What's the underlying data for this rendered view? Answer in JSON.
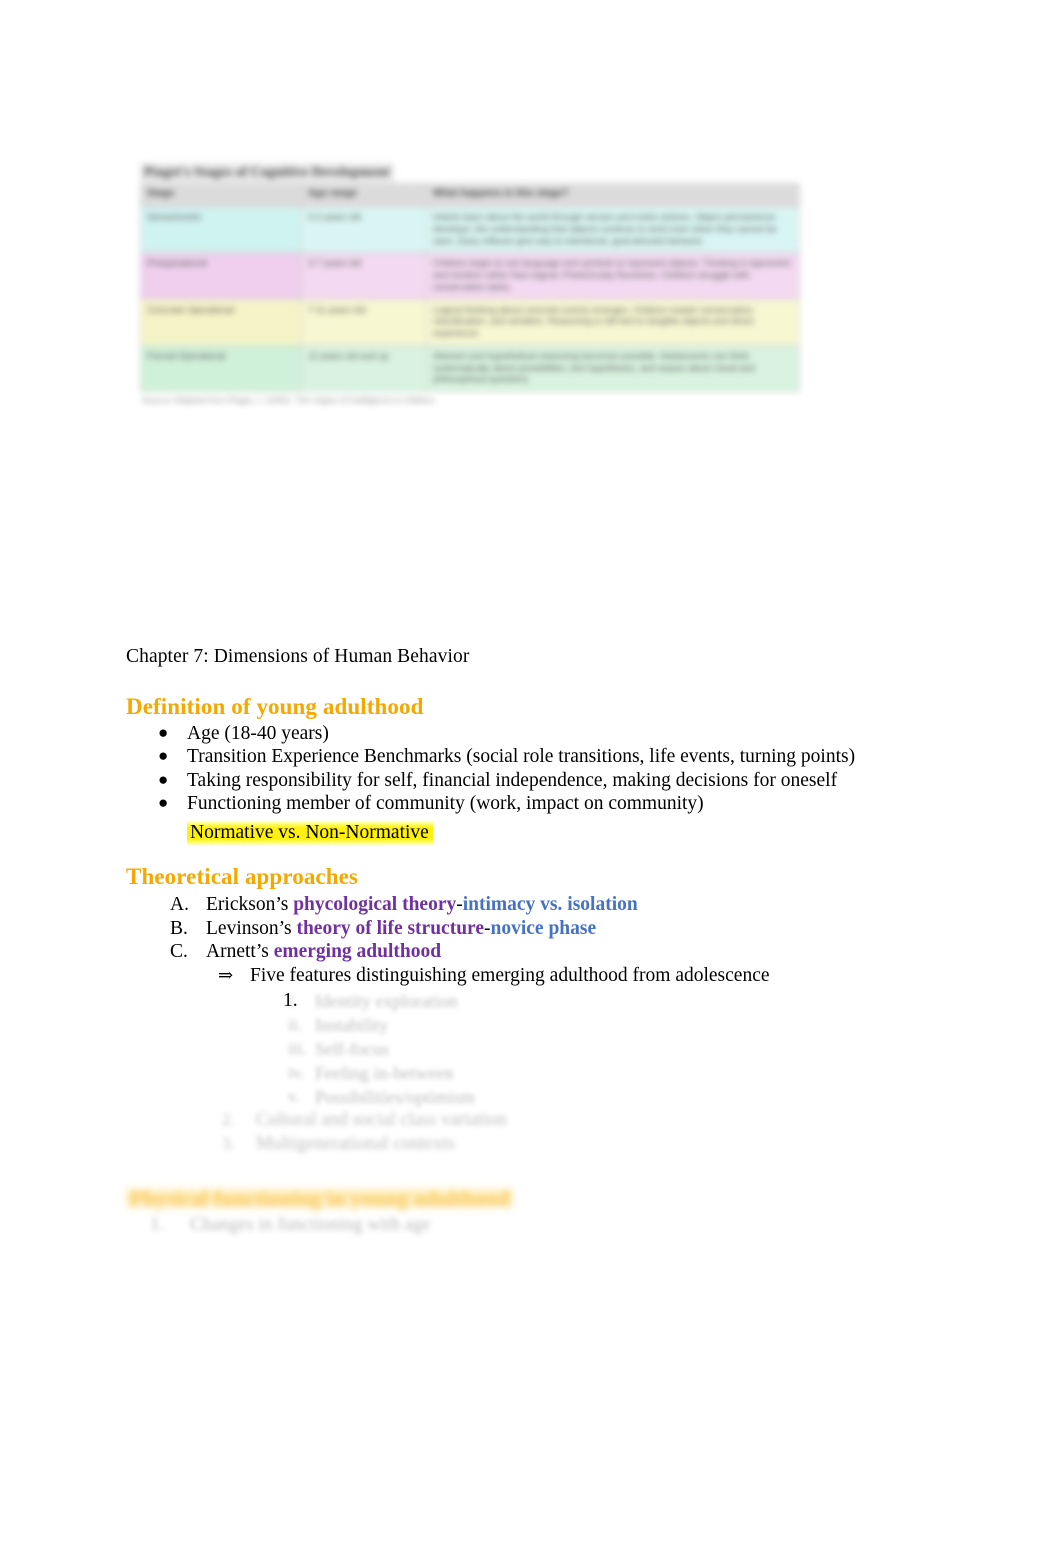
{
  "document": {
    "chapter_title": "Chapter 7: Dimensions of Human Behavior"
  },
  "figure": {
    "title": "Piaget's Stages of Cognitive Development",
    "caption": "Source: Adapted from Piaget, J. (1952). The origins of intelligence in children.",
    "columns": [
      "Stage",
      "Age range",
      "What happens in this stage?"
    ],
    "rows": [
      {
        "stage": "Sensorimotor",
        "age": "0-2 years old",
        "what": "Infants learn about the world through senses and motor actions. Object permanence develops: the understanding that objects continue to exist even when they cannot be seen. Early reflexes give way to intentional, goal-directed behavior."
      },
      {
        "stage": "Preoperational",
        "age": "2-7 years old",
        "what": "Children begin to use language and symbols to represent objects. Thinking is egocentric and intuitive rather than logical. Pretend play flourishes. Children struggle with conservation tasks."
      },
      {
        "stage": "Concrete Operational",
        "age": "7-11 years old",
        "what": "Logical thinking about concrete events emerges. Children master conservation, classification, and seriation. Reasoning is still tied to tangible objects and direct experience."
      },
      {
        "stage": "Formal Operational",
        "age": "12 years old and up",
        "what": "Abstract and hypothetical reasoning becomes possible. Adolescents can think systematically about possibilities, test hypotheses, and reason about moral and philosophical questions."
      }
    ]
  },
  "sections": [
    {
      "heading": "Definition of young adulthood",
      "bullets": [
        "Age (18-40 years)",
        "Transition Experience Benchmarks (social role transitions, life events, turning points)",
        "Taking responsibility for self, financial independence, making decisions for oneself",
        "Functioning member of community (work, impact on community)"
      ],
      "highlighted_note": "Normative vs. Non-Normative"
    },
    {
      "heading": "Theoretical approaches",
      "items": [
        {
          "marker": "A.",
          "lead": "Erickson’s ",
          "purple": "phycological theory",
          "dash": "-",
          "blue": "intimacy vs. isolation"
        },
        {
          "marker": "B.",
          "lead": "Levinson’s ",
          "purple": "theory of life structure",
          "dash": "-",
          "blue": "novice phase"
        },
        {
          "marker": "C.",
          "lead": "Arnett’s ",
          "purple": "emerging adulthood",
          "dash": "",
          "blue": ""
        }
      ],
      "arrow_marker": "⇒",
      "arrow_text": "Five features distinguishing emerging adulthood from adolescence",
      "numbered_marker": "1.",
      "faded_subitems": [
        {
          "marker": "i.",
          "text": "Identity exploration"
        },
        {
          "marker": "ii.",
          "text": "Instability"
        },
        {
          "marker": "iii.",
          "text": "Self-focus"
        },
        {
          "marker": "iv.",
          "text": "Feeling in-between"
        },
        {
          "marker": "v.",
          "text": "Possibilities/optimism"
        }
      ],
      "faded_roman": [
        {
          "marker": "2.",
          "text": "Cultural and social class variation"
        },
        {
          "marker": "3.",
          "text": "Multigenerational contexts"
        }
      ]
    },
    {
      "faded_heading": "Physical functioning in young adulthood",
      "faded_item": {
        "marker": "1.",
        "text": "Changes in functioning with age"
      }
    }
  ],
  "colors": {
    "heading_orange": "#f5a800",
    "theory_purple": "#7030a0",
    "theory_blue": "#4472c4",
    "highlight_yellow": "#fff000",
    "table_header_grey": "#d9d9d9",
    "row_sensorimotor": "#d6f5f2",
    "row_preoperational": "#f2d6f0",
    "row_concrete": "#f7f7cf",
    "row_formal": "#d6f2de"
  }
}
